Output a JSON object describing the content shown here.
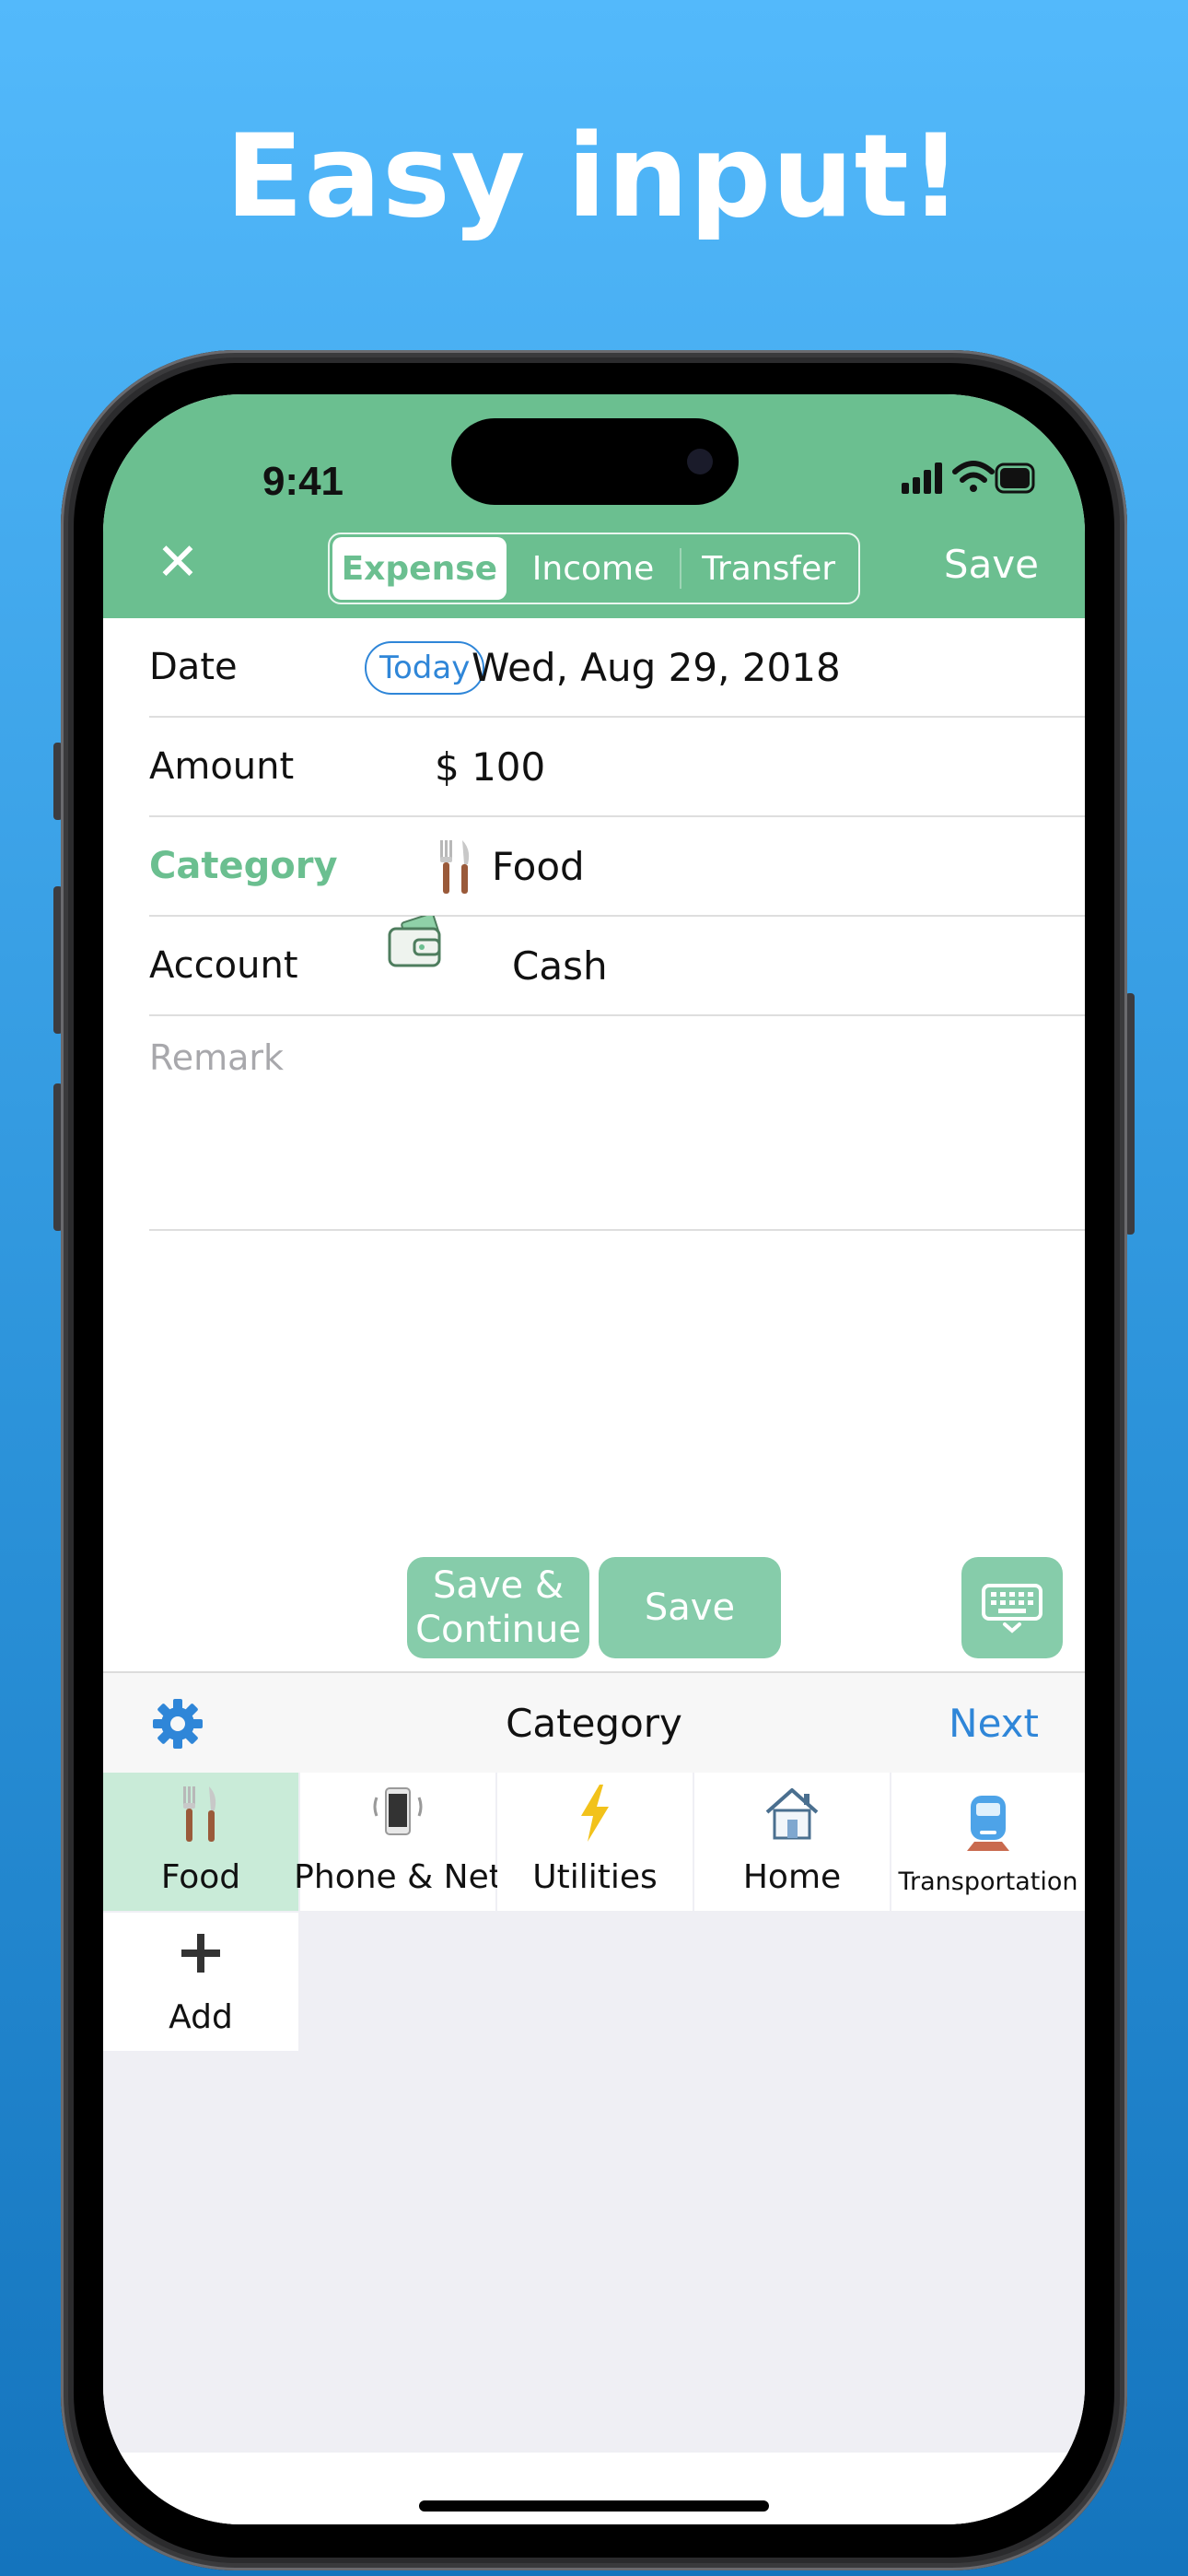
{
  "headline": "Easy input!",
  "status_bar": {
    "time": "9:41"
  },
  "navbar": {
    "close_icon": "close-icon",
    "segments": [
      "Expense",
      "Income",
      "Transfer"
    ],
    "active_segment": "Expense",
    "save_label": "Save",
    "color": "#6bbf90"
  },
  "form": {
    "date": {
      "label": "Date",
      "today_label": "Today",
      "value": "Wed, Aug 29, 2018"
    },
    "amount": {
      "label": "Amount",
      "value": "$ 100"
    },
    "category": {
      "label": "Category",
      "value": "Food",
      "icon": "fork-knife-icon"
    },
    "account": {
      "label": "Account",
      "value": "Cash",
      "icon": "wallet-icon"
    },
    "remark": {
      "placeholder": "Remark"
    }
  },
  "actions": {
    "save_continue_line1": "Save &",
    "save_continue_line2": "Continue",
    "save_label": "Save",
    "keyboard_icon": "keyboard-icon"
  },
  "category_panel": {
    "title": "Category",
    "next_label": "Next",
    "settings_icon": "gear-icon",
    "items": [
      {
        "label": "Food",
        "icon": "fork-knife-icon",
        "selected": true
      },
      {
        "label": "Phone & Net",
        "icon": "phone-icon",
        "selected": false
      },
      {
        "label": "Utilities",
        "icon": "lightning-icon",
        "selected": false
      },
      {
        "label": "Home",
        "icon": "house-icon",
        "selected": false
      },
      {
        "label": "Transportation",
        "icon": "train-icon",
        "selected": false
      },
      {
        "label": "Add",
        "icon": "plus-icon",
        "selected": false
      }
    ]
  }
}
